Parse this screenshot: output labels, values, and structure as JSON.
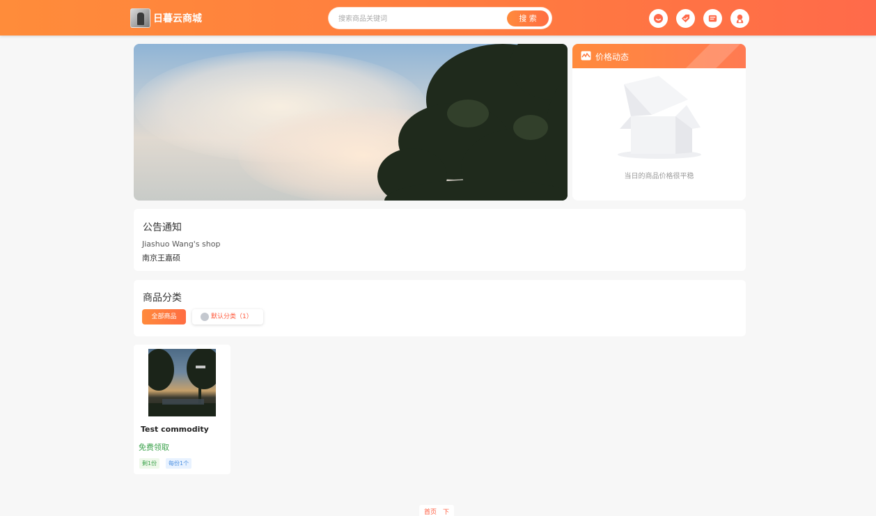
{
  "header": {
    "brand_name": "日暮云商城",
    "search_placeholder": "搜索商品关键词",
    "search_button": "搜 索",
    "icons": [
      "smile-icon",
      "tag-icon",
      "mail-icon",
      "user-icon"
    ]
  },
  "price_panel": {
    "title": "价格动态",
    "message": "当日的商品价格很平稳"
  },
  "notice": {
    "title": "公告通知",
    "line1": "Jiashuo Wang's shop",
    "line2": "南京王嘉硕"
  },
  "categories": {
    "title": "商品分类",
    "all_label": "全部商品",
    "default_label": "默认分类（1）"
  },
  "product": {
    "name": "Test commodity",
    "price": "免费领取",
    "tag_stock": "剩1份",
    "tag_limit": "每份1个"
  },
  "pager": {
    "label": "首页　下"
  },
  "colors": {
    "accent": "#ff7a40",
    "price_green": "#3aa14a",
    "tag_blue": "#4a8fe0"
  }
}
